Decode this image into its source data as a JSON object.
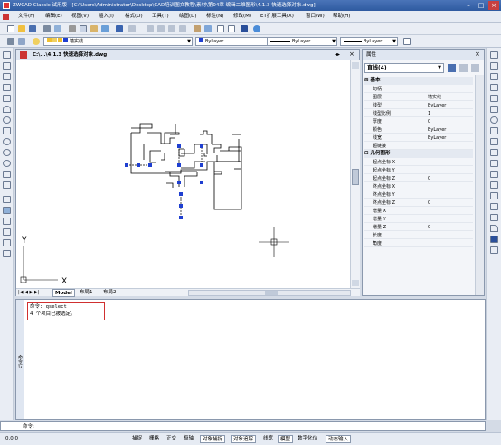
{
  "window": {
    "title": "ZWCAD Classic 试用版 - [C:\\Users\\Administrator\\Desktop\\CAD培训图文教程\\素材\\第04章 编辑二维图形\\4.1.3 快速选择对象.dwg]",
    "minimize": "–",
    "maximize": "□",
    "close": "×"
  },
  "menu": [
    "文件(F)",
    "编辑(E)",
    "视图(V)",
    "插入(I)",
    "格式(O)",
    "工具(T)",
    "绘图(D)",
    "标注(N)",
    "修改(M)",
    "ET扩展工具(X)",
    "窗口(W)",
    "帮助(H)"
  ],
  "toolbar2": {
    "layer_value": "墙实线",
    "color_value": "ByLayer",
    "linetype_value": "ByLayer",
    "lineweight_value": "ByLayer"
  },
  "drawing": {
    "tab_label": "C:\\...\\4.1.3 快速选择对象.dwg",
    "layout_tabs": [
      "Model",
      "布局1",
      "布局2"
    ],
    "axis_x": "X",
    "axis_y": "Y"
  },
  "properties": {
    "title": "属性",
    "selection": "直线(4)",
    "sections": {
      "basic": "基本",
      "geometry": "几何图形"
    },
    "basic_rows": [
      {
        "k": "句柄",
        "v": ""
      },
      {
        "k": "图层",
        "v": "墙实线"
      },
      {
        "k": "线型",
        "v": "ByLayer"
      },
      {
        "k": "线型比例",
        "v": "1"
      },
      {
        "k": "厚度",
        "v": "0"
      },
      {
        "k": "颜色",
        "v": "ByLayer"
      },
      {
        "k": "线宽",
        "v": "ByLayer"
      },
      {
        "k": "超链接",
        "v": ""
      }
    ],
    "geometry_rows": [
      {
        "k": "起点坐标 X",
        "v": ""
      },
      {
        "k": "起点坐标 Y",
        "v": ""
      },
      {
        "k": "起点坐标 Z",
        "v": "0"
      },
      {
        "k": "终点坐标 X",
        "v": ""
      },
      {
        "k": "终点坐标 Y",
        "v": ""
      },
      {
        "k": "终点坐标 Z",
        "v": "0"
      },
      {
        "k": "增量 X",
        "v": ""
      },
      {
        "k": "增量 Y",
        "v": ""
      },
      {
        "k": "增量 Z",
        "v": "0"
      },
      {
        "k": "长度",
        "v": ""
      },
      {
        "k": "角度",
        "v": ""
      }
    ]
  },
  "command": {
    "sidebar_label": "命令行",
    "history": [
      "命令: qselect",
      "4 个项目已被选定。"
    ],
    "prompt": "命令:"
  },
  "status": {
    "coords": "0,0,0",
    "buttons": [
      "捕捉",
      "栅格",
      "正交",
      "极轴",
      "对象捕捉",
      "对象追踪",
      "线宽",
      "模型",
      "数字化仪",
      "动态输入"
    ],
    "active": [
      4,
      5,
      7,
      9
    ]
  },
  "colors": {
    "grip": "#1f3fd0",
    "titlebar": "#2e5aa0"
  }
}
